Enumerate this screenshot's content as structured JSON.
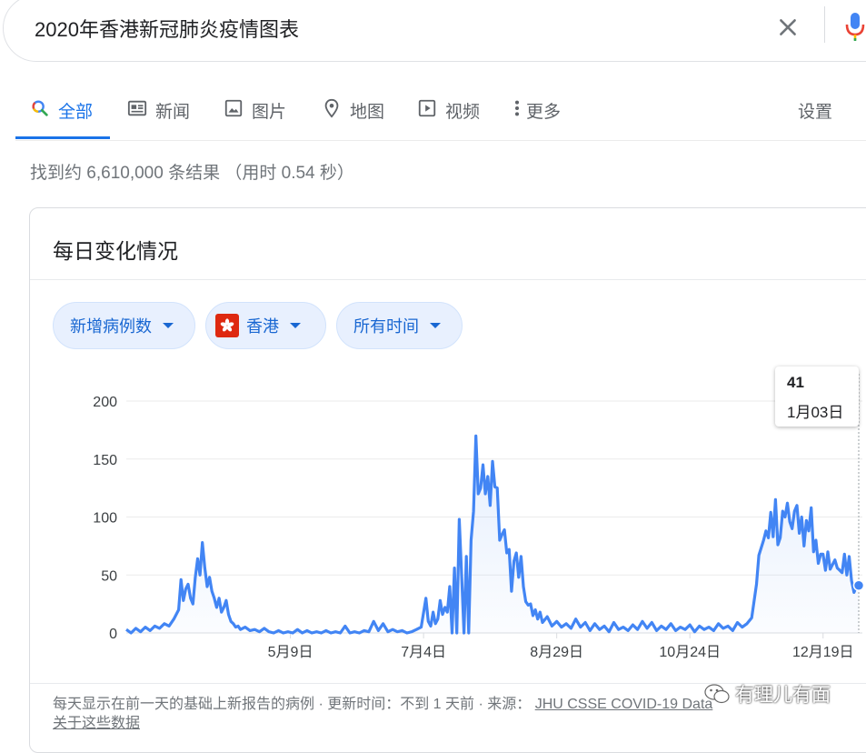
{
  "search": {
    "query": "2020年香港新冠肺炎疫情图表"
  },
  "tabs": [
    {
      "label": "全部",
      "icon": "search-icon",
      "active": true
    },
    {
      "label": "新闻",
      "icon": "news-icon"
    },
    {
      "label": "图片",
      "icon": "image-icon"
    },
    {
      "label": "地图",
      "icon": "map-pin-icon"
    },
    {
      "label": "视频",
      "icon": "play-icon"
    },
    {
      "label": "更多",
      "icon": "more-vert-icon"
    }
  ],
  "settings_label": "设置",
  "result_stats": "找到约 6,610,000 条结果 （用时 0.54 秒）",
  "card": {
    "title": "每日变化情况",
    "chips": [
      {
        "label": "新增病例数"
      },
      {
        "label": "香港",
        "icon": "hong-kong-flag-icon"
      },
      {
        "label": "所有时间"
      }
    ],
    "tooltip": {
      "value": "41",
      "date": "1月03日"
    },
    "footer_text": "每天显示在前一天的基础上新报告的病例 · 更新时间：不到 1 天前 · 来源：",
    "footer_source": "JHU CSSE COVID-19 Data",
    "footer_link": "关于这些数据"
  },
  "watermark": {
    "text": "有理儿有面",
    "icon": "wechat-icon"
  },
  "colors": {
    "accent": "#1a73e8",
    "line": "#4285f4",
    "chip_bg": "#e8f0fe"
  },
  "chart_data": {
    "type": "line",
    "ylim": [
      0,
      200
    ],
    "yticks": [
      "0",
      "50",
      "100",
      "150",
      "200"
    ],
    "xticks": [
      "5月9日",
      "7月4日",
      "8月29日",
      "10月24日",
      "12月19日"
    ],
    "x_start": "2020-03-01",
    "x_end": "2021-01-03",
    "grid": true,
    "series": [
      {
        "points": [
          [
            "2020-03-01",
            3
          ],
          [
            "2020-03-03",
            0
          ],
          [
            "2020-03-05",
            4
          ],
          [
            "2020-03-07",
            1
          ],
          [
            "2020-03-09",
            5
          ],
          [
            "2020-03-11",
            2
          ],
          [
            "2020-03-13",
            6
          ],
          [
            "2020-03-15",
            4
          ],
          [
            "2020-03-17",
            8
          ],
          [
            "2020-03-19",
            6
          ],
          [
            "2020-03-21",
            12
          ],
          [
            "2020-03-23",
            20
          ],
          [
            "2020-03-24",
            46
          ],
          [
            "2020-03-25",
            28
          ],
          [
            "2020-03-26",
            38
          ],
          [
            "2020-03-27",
            42
          ],
          [
            "2020-03-28",
            30
          ],
          [
            "2020-03-29",
            25
          ],
          [
            "2020-03-30",
            48
          ],
          [
            "2020-03-31",
            64
          ],
          [
            "2020-04-01",
            50
          ],
          [
            "2020-04-02",
            78
          ],
          [
            "2020-04-03",
            56
          ],
          [
            "2020-04-04",
            40
          ],
          [
            "2020-04-05",
            48
          ],
          [
            "2020-04-06",
            36
          ],
          [
            "2020-04-07",
            30
          ],
          [
            "2020-04-08",
            22
          ],
          [
            "2020-04-09",
            30
          ],
          [
            "2020-04-10",
            18
          ],
          [
            "2020-04-11",
            22
          ],
          [
            "2020-04-12",
            28
          ],
          [
            "2020-04-13",
            16
          ],
          [
            "2020-04-14",
            10
          ],
          [
            "2020-04-15",
            8
          ],
          [
            "2020-04-16",
            5
          ],
          [
            "2020-04-17",
            6
          ],
          [
            "2020-04-18",
            3
          ],
          [
            "2020-04-20",
            5
          ],
          [
            "2020-04-22",
            2
          ],
          [
            "2020-04-24",
            3
          ],
          [
            "2020-04-26",
            1
          ],
          [
            "2020-04-28",
            4
          ],
          [
            "2020-04-30",
            1
          ],
          [
            "2020-05-02",
            0
          ],
          [
            "2020-05-04",
            2
          ],
          [
            "2020-05-06",
            0
          ],
          [
            "2020-05-08",
            1
          ],
          [
            "2020-05-10",
            0
          ],
          [
            "2020-05-12",
            3
          ],
          [
            "2020-05-14",
            0
          ],
          [
            "2020-05-16",
            2
          ],
          [
            "2020-05-18",
            0
          ],
          [
            "2020-05-20",
            1
          ],
          [
            "2020-05-22",
            0
          ],
          [
            "2020-05-24",
            2
          ],
          [
            "2020-05-26",
            0
          ],
          [
            "2020-05-28",
            1
          ],
          [
            "2020-05-30",
            0
          ],
          [
            "2020-06-01",
            6
          ],
          [
            "2020-06-03",
            0
          ],
          [
            "2020-06-05",
            1
          ],
          [
            "2020-06-07",
            0
          ],
          [
            "2020-06-09",
            2
          ],
          [
            "2020-06-11",
            1
          ],
          [
            "2020-06-13",
            10
          ],
          [
            "2020-06-15",
            2
          ],
          [
            "2020-06-17",
            8
          ],
          [
            "2020-06-19",
            1
          ],
          [
            "2020-06-21",
            3
          ],
          [
            "2020-06-23",
            1
          ],
          [
            "2020-06-25",
            2
          ],
          [
            "2020-06-27",
            0
          ],
          [
            "2020-06-29",
            1
          ],
          [
            "2020-07-01",
            3
          ],
          [
            "2020-07-03",
            5
          ],
          [
            "2020-07-05",
            30
          ],
          [
            "2020-07-06",
            10
          ],
          [
            "2020-07-07",
            6
          ],
          [
            "2020-07-08",
            18
          ],
          [
            "2020-07-09",
            8
          ],
          [
            "2020-07-10",
            12
          ],
          [
            "2020-07-11",
            28
          ],
          [
            "2020-07-12",
            16
          ],
          [
            "2020-07-13",
            22
          ],
          [
            "2020-07-14",
            18
          ],
          [
            "2020-07-15",
            40
          ],
          [
            "2020-07-16",
            0
          ],
          [
            "2020-07-17",
            56
          ],
          [
            "2020-07-18",
            0
          ],
          [
            "2020-07-19",
            98
          ],
          [
            "2020-07-20",
            50
          ],
          [
            "2020-07-21",
            0
          ],
          [
            "2020-07-22",
            66
          ],
          [
            "2020-07-23",
            0
          ],
          [
            "2020-07-24",
            80
          ],
          [
            "2020-07-25",
            105
          ],
          [
            "2020-07-26",
            170
          ],
          [
            "2020-07-27",
            120
          ],
          [
            "2020-07-28",
            125
          ],
          [
            "2020-07-29",
            145
          ],
          [
            "2020-07-30",
            120
          ],
          [
            "2020-07-31",
            135
          ],
          [
            "2020-08-01",
            110
          ],
          [
            "2020-08-02",
            148
          ],
          [
            "2020-08-03",
            126
          ],
          [
            "2020-08-04",
            125
          ],
          [
            "2020-08-05",
            80
          ],
          [
            "2020-08-06",
            85
          ],
          [
            "2020-08-07",
            89
          ],
          [
            "2020-08-08",
            69
          ],
          [
            "2020-08-09",
            72
          ],
          [
            "2020-08-10",
            36
          ],
          [
            "2020-08-11",
            62
          ],
          [
            "2020-08-12",
            69
          ],
          [
            "2020-08-13",
            48
          ],
          [
            "2020-08-14",
            66
          ],
          [
            "2020-08-15",
            40
          ],
          [
            "2020-08-16",
            27
          ],
          [
            "2020-08-17",
            24
          ],
          [
            "2020-08-18",
            25
          ],
          [
            "2020-08-19",
            15
          ],
          [
            "2020-08-20",
            20
          ],
          [
            "2020-08-21",
            12
          ],
          [
            "2020-08-22",
            18
          ],
          [
            "2020-08-23",
            9
          ],
          [
            "2020-08-25",
            14
          ],
          [
            "2020-08-27",
            6
          ],
          [
            "2020-08-29",
            10
          ],
          [
            "2020-08-31",
            5
          ],
          [
            "2020-09-02",
            8
          ],
          [
            "2020-09-04",
            4
          ],
          [
            "2020-09-06",
            12
          ],
          [
            "2020-09-08",
            5
          ],
          [
            "2020-09-10",
            9
          ],
          [
            "2020-09-12",
            2
          ],
          [
            "2020-09-14",
            8
          ],
          [
            "2020-09-16",
            3
          ],
          [
            "2020-09-18",
            6
          ],
          [
            "2020-09-20",
            1
          ],
          [
            "2020-09-22",
            9
          ],
          [
            "2020-09-24",
            3
          ],
          [
            "2020-09-26",
            5
          ],
          [
            "2020-09-28",
            2
          ],
          [
            "2020-09-30",
            7
          ],
          [
            "2020-10-02",
            3
          ],
          [
            "2020-10-04",
            10
          ],
          [
            "2020-10-06",
            4
          ],
          [
            "2020-10-08",
            9
          ],
          [
            "2020-10-10",
            2
          ],
          [
            "2020-10-12",
            6
          ],
          [
            "2020-10-14",
            3
          ],
          [
            "2020-10-16",
            8
          ],
          [
            "2020-10-18",
            2
          ],
          [
            "2020-10-20",
            5
          ],
          [
            "2020-10-22",
            3
          ],
          [
            "2020-10-24",
            7
          ],
          [
            "2020-10-26",
            1
          ],
          [
            "2020-10-28",
            6
          ],
          [
            "2020-10-30",
            3
          ],
          [
            "2020-11-01",
            5
          ],
          [
            "2020-11-03",
            2
          ],
          [
            "2020-11-05",
            8
          ],
          [
            "2020-11-07",
            4
          ],
          [
            "2020-11-09",
            6
          ],
          [
            "2020-11-11",
            2
          ],
          [
            "2020-11-13",
            9
          ],
          [
            "2020-11-15",
            5
          ],
          [
            "2020-11-17",
            8
          ],
          [
            "2020-11-19",
            13
          ],
          [
            "2020-11-21",
            42
          ],
          [
            "2020-11-22",
            67
          ],
          [
            "2020-11-24",
            80
          ],
          [
            "2020-11-25",
            88
          ],
          [
            "2020-11-26",
            82
          ],
          [
            "2020-11-27",
            104
          ],
          [
            "2020-11-28",
            83
          ],
          [
            "2020-11-29",
            115
          ],
          [
            "2020-11-30",
            76
          ],
          [
            "2020-12-01",
            82
          ],
          [
            "2020-12-02",
            105
          ],
          [
            "2020-12-03",
            100
          ],
          [
            "2020-12-04",
            112
          ],
          [
            "2020-12-05",
            96
          ],
          [
            "2020-12-06",
            90
          ],
          [
            "2020-12-07",
            105
          ],
          [
            "2020-12-08",
            110
          ],
          [
            "2020-12-09",
            86
          ],
          [
            "2020-12-10",
            100
          ],
          [
            "2020-12-11",
            75
          ],
          [
            "2020-12-12",
            97
          ],
          [
            "2020-12-13",
            88
          ],
          [
            "2020-12-14",
            108
          ],
          [
            "2020-12-15",
            70
          ],
          [
            "2020-12-16",
            80
          ],
          [
            "2020-12-17",
            60
          ],
          [
            "2020-12-18",
            68
          ],
          [
            "2020-12-19",
            68
          ],
          [
            "2020-12-20",
            54
          ],
          [
            "2020-12-21",
            70
          ],
          [
            "2020-12-22",
            55
          ],
          [
            "2020-12-23",
            59
          ],
          [
            "2020-12-24",
            63
          ],
          [
            "2020-12-25",
            56
          ],
          [
            "2020-12-26",
            54
          ],
          [
            "2020-12-27",
            52
          ],
          [
            "2020-12-28",
            68
          ],
          [
            "2020-12-29",
            50
          ],
          [
            "2020-12-30",
            66
          ],
          [
            "2020-12-31",
            45
          ],
          [
            "2021-01-01",
            35
          ],
          [
            "2021-01-02",
            40
          ],
          [
            "2021-01-03",
            41
          ]
        ]
      }
    ]
  }
}
